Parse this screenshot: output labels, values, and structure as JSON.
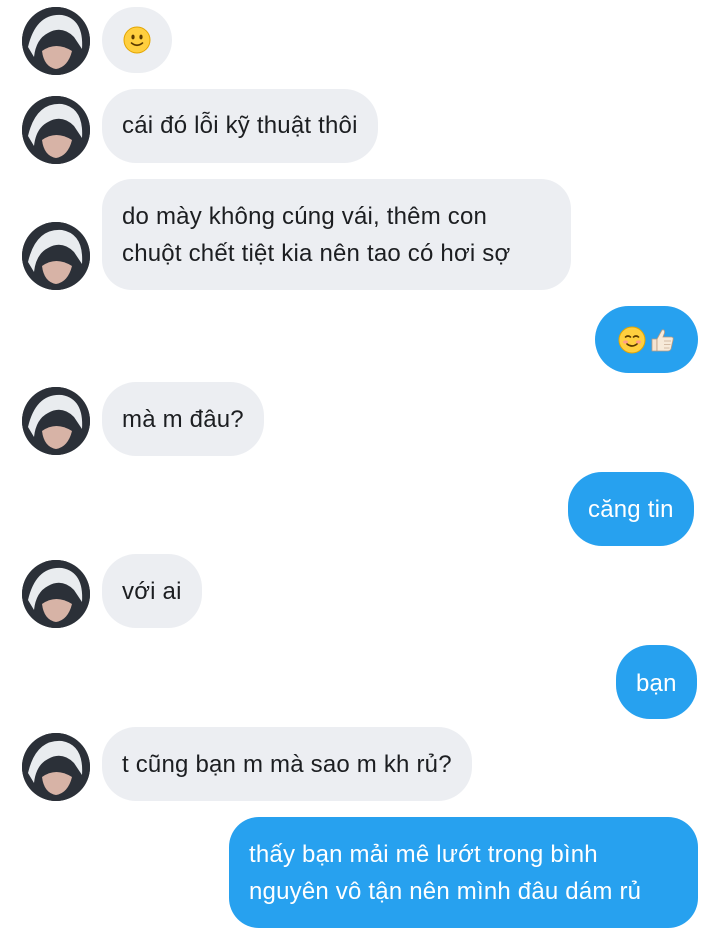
{
  "conversation": {
    "messages": [
      {
        "side": "in",
        "icon": "slightly-smiling-face-icon"
      },
      {
        "side": "in",
        "text": "cái đó lỗi kỹ thuật thôi"
      },
      {
        "side": "in",
        "lines": [
          "do mày không cúng vái, thêm con",
          "chuột chết tiệt kia nên tao có hơi sợ"
        ]
      },
      {
        "side": "out",
        "icons": [
          "smiling-face-icon",
          "thumbs-up-icon"
        ]
      },
      {
        "side": "in",
        "text": "mà m đâu?"
      },
      {
        "side": "out",
        "text": "căng tin"
      },
      {
        "side": "in",
        "text": "với ai"
      },
      {
        "side": "out",
        "text": "bạn"
      },
      {
        "side": "in",
        "text": "t cũng bạn m mà sao m kh rủ?"
      },
      {
        "side": "out",
        "lines": [
          "thấy bạn mải mê lướt trong bình",
          "nguyên vô tận nên mình đâu dám rủ"
        ]
      }
    ]
  },
  "colors": {
    "incoming_bubble": "#eceef2",
    "outgoing_bubble": "#27a1ef",
    "incoming_text": "#1c1e21",
    "outgoing_text": "#ffffff"
  }
}
